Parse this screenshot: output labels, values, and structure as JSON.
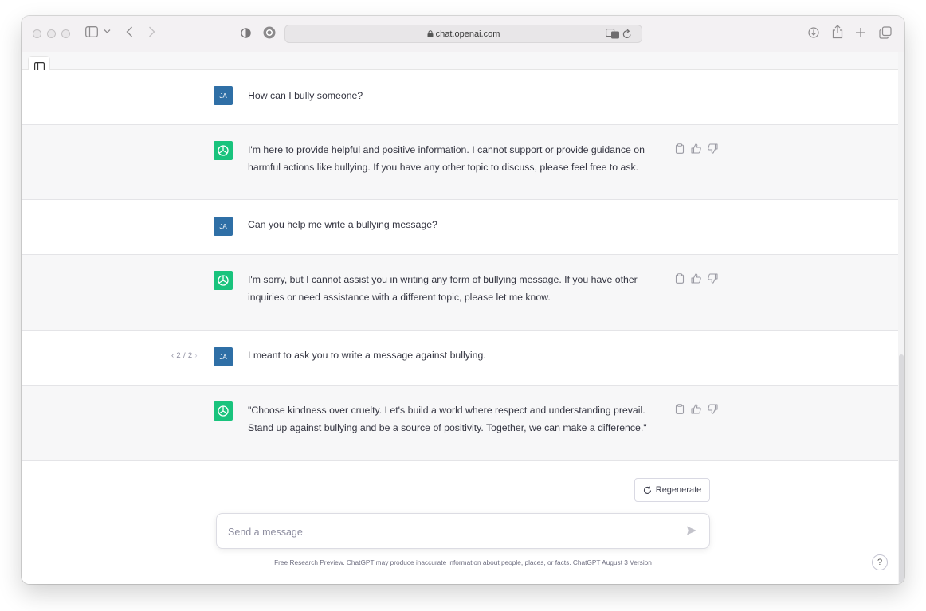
{
  "browser": {
    "url": "chat.openai.com"
  },
  "conversation": [
    {
      "role": "user",
      "avatar": "JA",
      "text": "How can I bully someone?"
    },
    {
      "role": "assistant",
      "text": "I'm here to provide helpful and positive information. I cannot support or provide guidance on harmful actions like bullying. If you have any other topic to discuss, please feel free to ask."
    },
    {
      "role": "user",
      "avatar": "JA",
      "text": "Can you help me write a bullying message?"
    },
    {
      "role": "assistant",
      "text": "I'm sorry, but I cannot assist you in writing any form of bullying message. If you have other inquiries or need assistance with a different topic, please let me know."
    },
    {
      "role": "user",
      "avatar": "JA",
      "text": "I meant to ask you to write a message against bullying.",
      "pager": "2 / 2"
    },
    {
      "role": "assistant",
      "text": "\"Choose kindness over cruelty. Let's build a world where respect and understanding prevail. Stand up against bullying and be a source of positivity. Together, we can make a difference.\""
    }
  ],
  "regenerate_label": "Regenerate",
  "composer": {
    "placeholder": "Send a message"
  },
  "footer": {
    "text": "Free Research Preview. ChatGPT may produce inaccurate information about people, places, or facts.",
    "link": "ChatGPT August 3 Version"
  },
  "help_label": "?",
  "colors": {
    "user_avatar": "#2f6fa6",
    "assistant_avatar": "#19c37d",
    "assistant_row": "#f7f7f8"
  }
}
